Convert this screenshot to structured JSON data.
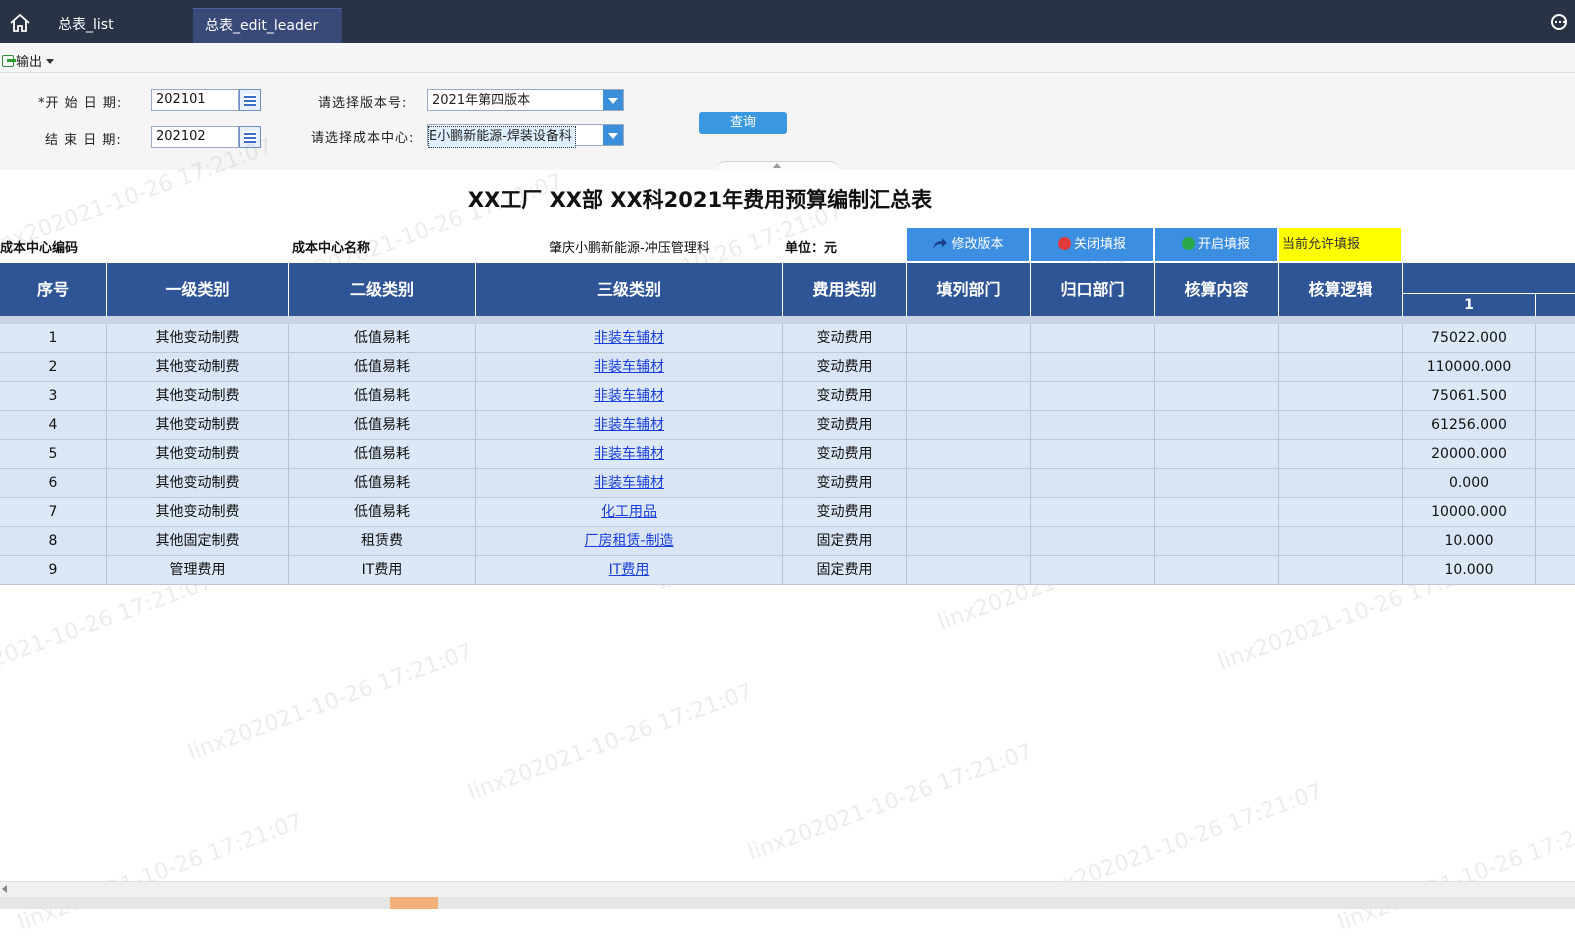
{
  "topbar": {
    "tabs": [
      "总表_list",
      "总表_edit_leader"
    ],
    "home_icon": "home-icon",
    "more_icon": "more-circle-icon"
  },
  "toolbar": {
    "export_label": "输出"
  },
  "filters": {
    "start_label": "*开 始 日 期:",
    "start_value": "202101",
    "end_label": "结 束 日 期:",
    "end_value": "202102",
    "version_label": "请选择版本号:",
    "version_value": "2021年第四版本",
    "cost_center_label": "请选择成本中心:",
    "cost_center_value": "E小鹏新能源-焊装设备科",
    "query_label": "查询"
  },
  "report": {
    "title": "XX工厂 XX部 XX科2021年费用预算编制汇总表",
    "cost_center_code_label": "成本中心编码",
    "cost_center_name_label": "成本中心名称",
    "cost_center_name_value": "肇庆小鹏新能源-冲压管理科",
    "unit_label": "单位：",
    "unit_value": "元",
    "btn_modify": "修改版本",
    "btn_close": "关闭填报",
    "btn_open": "开启填报",
    "status_text": "当前允许填报"
  },
  "table": {
    "headers": [
      "序号",
      "一级类别",
      "二级类别",
      "三级类别",
      "费用类别",
      "填列部门",
      "归口部门",
      "核算内容",
      "核算逻辑"
    ],
    "month_header": "1",
    "rows": [
      {
        "no": "1",
        "l1": "其他变动制费",
        "l2": "低值易耗",
        "l3": "非装车辅材",
        "type": "变动费用",
        "m1": "75022.000"
      },
      {
        "no": "2",
        "l1": "其他变动制费",
        "l2": "低值易耗",
        "l3": "非装车辅材",
        "type": "变动费用",
        "m1": "110000.000"
      },
      {
        "no": "3",
        "l1": "其他变动制费",
        "l2": "低值易耗",
        "l3": "非装车辅材",
        "type": "变动费用",
        "m1": "75061.500"
      },
      {
        "no": "4",
        "l1": "其他变动制费",
        "l2": "低值易耗",
        "l3": "非装车辅材",
        "type": "变动费用",
        "m1": "61256.000"
      },
      {
        "no": "5",
        "l1": "其他变动制费",
        "l2": "低值易耗",
        "l3": "非装车辅材",
        "type": "变动费用",
        "m1": "20000.000"
      },
      {
        "no": "6",
        "l1": "其他变动制费",
        "l2": "低值易耗",
        "l3": "非装车辅材",
        "type": "变动费用",
        "m1": "0.000"
      },
      {
        "no": "7",
        "l1": "其他变动制费",
        "l2": "低值易耗",
        "l3": "化工用品",
        "type": "变动费用",
        "m1": "10000.000"
      },
      {
        "no": "8",
        "l1": "其他固定制费",
        "l2": "租赁费",
        "l3": "厂房租赁-制造",
        "type": "固定费用",
        "m1": "10.000"
      },
      {
        "no": "9",
        "l1": "管理费用",
        "l2": "IT费用",
        "l3": "IT费用",
        "type": "固定费用",
        "m1": "10.000"
      }
    ]
  },
  "watermark": "linx202021-10-26 17:21:07",
  "colors": {
    "topbar": "#2a3246",
    "header": "#2f5597",
    "button": "#3b8ee0",
    "allow": "#ffff00"
  }
}
